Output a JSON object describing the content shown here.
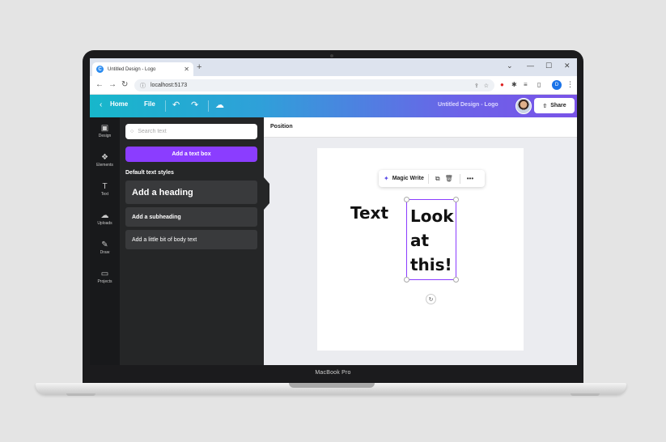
{
  "browser": {
    "tab_title": "Untitled Design - Logo",
    "url": "localhost:5173",
    "profile_initial": "D"
  },
  "header": {
    "home_label": "Home",
    "file_label": "File",
    "doc_title": "Untitled Design - Logo",
    "share_label": "Share"
  },
  "rail": {
    "design": "Design",
    "elements": "Elements",
    "text": "Text",
    "uploads": "Uploads",
    "draw": "Draw",
    "projects": "Projects"
  },
  "panel": {
    "search_placeholder": "Search text",
    "add_textbox_label": "Add a text box",
    "default_styles_label": "Default text styles",
    "heading_label": "Add a heading",
    "subheading_label": "Add a subheading",
    "body_label": "Add a little bit of body text"
  },
  "editor": {
    "position_label": "Position",
    "magic_write_label": "Magic Write",
    "text_element": "Text",
    "selected_lines": [
      "Look",
      "at",
      "this!"
    ]
  },
  "device": {
    "label": "MacBook Pro"
  },
  "colors": {
    "accent": "#8b3dff",
    "header_start": "#17b7cb",
    "header_end": "#7a53e8",
    "panel_bg": "#252627",
    "rail_bg": "#18191b"
  }
}
